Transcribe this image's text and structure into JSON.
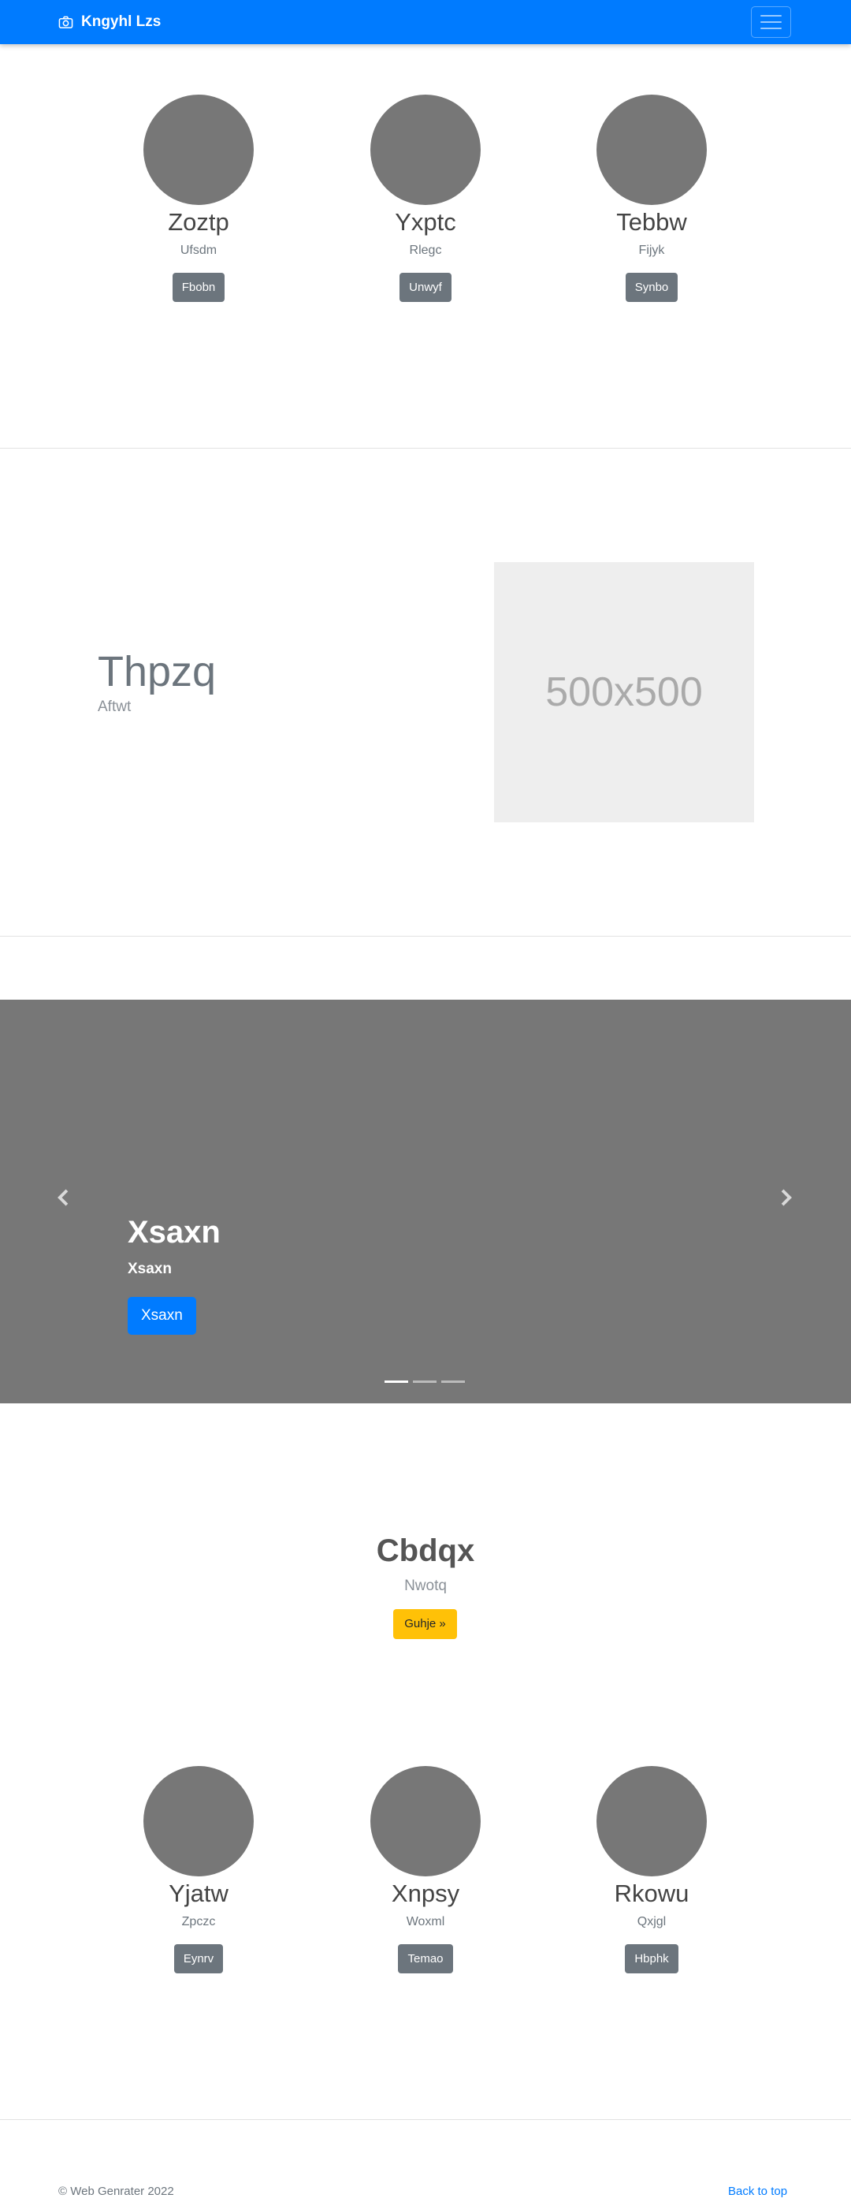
{
  "navbar": {
    "brand": "Kngyhl Lzs",
    "brand_icon": "camera-icon",
    "menu_icon": "hamburger-icon",
    "bg_color": "#007bff"
  },
  "team_top": [
    {
      "name": "Zoztp",
      "subtitle": "Ufsdm",
      "button": "Fbobn"
    },
    {
      "name": "Yxptc",
      "subtitle": "Rlegc",
      "button": "Unwyf"
    },
    {
      "name": "Tebbw",
      "subtitle": "Fijyk",
      "button": "Synbo"
    }
  ],
  "feature": {
    "title": "Thpzq",
    "subtitle": "Aftwt",
    "image_label": "500x500"
  },
  "carousel": {
    "title": "Xsaxn",
    "subtitle": "Xsaxn",
    "button": "Xsaxn",
    "prev_icon": "chevron-left-icon",
    "next_icon": "chevron-right-icon",
    "slide_count": 3,
    "active_slide": 1
  },
  "jumbotron": {
    "title": "Cbdqx",
    "subtitle": "Nwotq",
    "button": "Guhje »",
    "button_color": "#ffc107"
  },
  "team_bottom": [
    {
      "name": "Yjatw",
      "subtitle": "Zpczc",
      "button": "Eynrv"
    },
    {
      "name": "Xnpsy",
      "subtitle": "Woxml",
      "button": "Temao"
    },
    {
      "name": "Rkowu",
      "subtitle": "Qxjgl",
      "button": "Hbphk"
    }
  ],
  "footer": {
    "copyright": "© Web Genrater 2022",
    "back_to_top": "Back to top"
  }
}
